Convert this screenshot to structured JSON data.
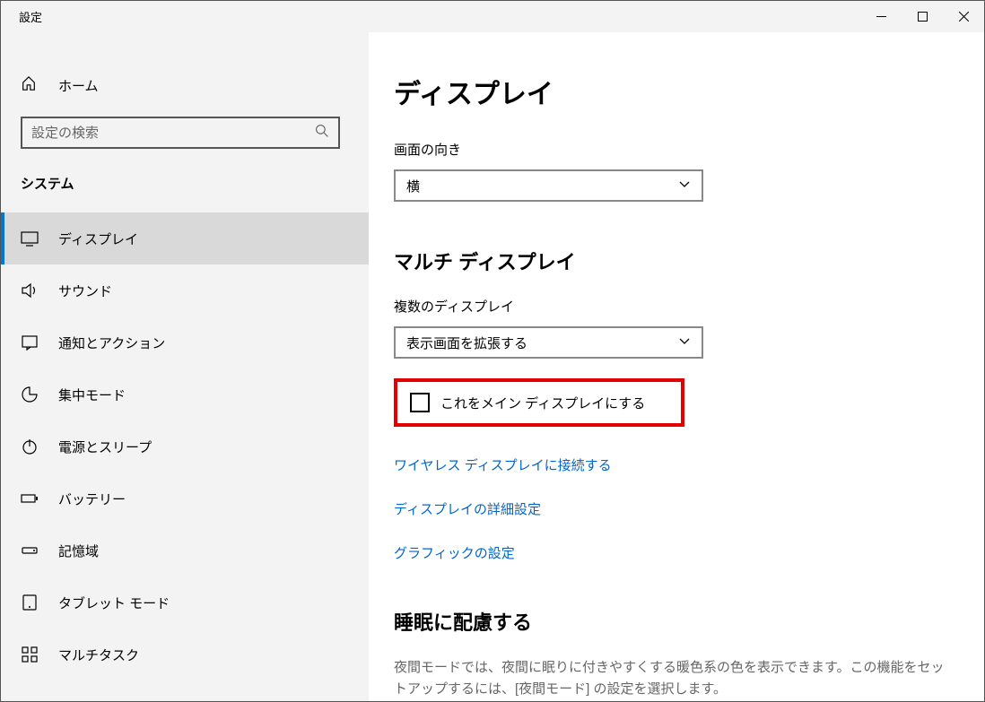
{
  "window": {
    "title": "設定"
  },
  "sidebar": {
    "home": "ホーム",
    "search_placeholder": "設定の検索",
    "category": "システム",
    "items": [
      {
        "label": "ディスプレイ"
      },
      {
        "label": "サウンド"
      },
      {
        "label": "通知とアクション"
      },
      {
        "label": "集中モード"
      },
      {
        "label": "電源とスリープ"
      },
      {
        "label": "バッテリー"
      },
      {
        "label": "記憶域"
      },
      {
        "label": "タブレット モード"
      },
      {
        "label": "マルチタスク"
      }
    ]
  },
  "content": {
    "title": "ディスプレイ",
    "orientation": {
      "label": "画面の向き",
      "value": "横"
    },
    "multi": {
      "heading": "マルチ ディスプレイ",
      "label": "複数のディスプレイ",
      "value": "表示画面を拡張する",
      "checkbox": "これをメイン ディスプレイにする"
    },
    "links": {
      "wireless": "ワイヤレス ディスプレイに接続する",
      "advanced": "ディスプレイの詳細設定",
      "graphics": "グラフィックの設定"
    },
    "sleep": {
      "heading": "睡眠に配慮する",
      "desc": "夜間モードでは、夜間に眠りに付きやすくする暖色系の色を表示できます。この機能をセットアップするには、[夜間モード] の設定を選択します。"
    }
  }
}
